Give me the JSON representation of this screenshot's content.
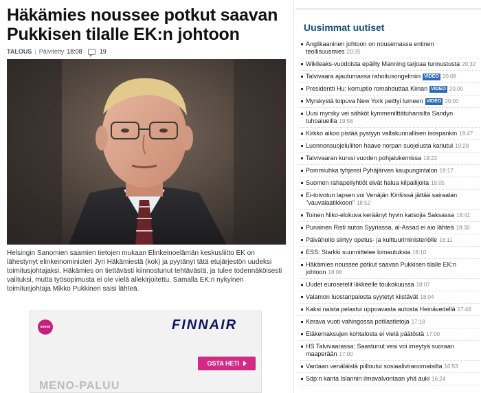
{
  "article": {
    "headline": "Häkämies noussee potkut saavan Pukkisen tilalle EK:n johtoon",
    "category": "TALOUS",
    "updated_label": "Päivitetty",
    "updated_time": "18:08",
    "comment_count": "19",
    "body": "Helsingin Sanomien saamien tietojen mukaan Elinkeinoelämän keskusliitto EK on lähestynyt elinkeinoministeri Jyri Häkämiestä (kok) ja pyytänyt tätä etujärjestön uudeksi toimitusjohtajaksi. Häkämies on tiettävästi kiinnostunut tehtävästä, ja tulee todennäköisesti valituksi, mutta työsopimusta ei ole vielä allekirjoitettu. Samalla EK:n nykyinen toimitusjohtaja Mikko Pukkinen saisi lähteä."
  },
  "ad": {
    "brand_small": "omnet",
    "logo": "FINNAIR",
    "cta": "OSTA HETI",
    "promo": "MENO-PALUU"
  },
  "sidebar": {
    "title": "Uusimmat uutiset",
    "video_label": "VIDEO",
    "items": [
      {
        "text": "Anglikaaninen johtoon on nousemassa entinen teollisuusmies",
        "time": "20:35",
        "video": false
      },
      {
        "text": "Wikileaks-vuodoista epäilty Manning tarjoaa tunnustusta",
        "time": "20:32",
        "video": false
      },
      {
        "text": "Talvivaara ajautumassa rahoitusongelmiin",
        "time": "20:08",
        "video": true
      },
      {
        "text": "Presidentti Hu: korruptio romahduttaa Kiinan",
        "time": "20:00",
        "video": true
      },
      {
        "text": "Myrskystä toipuva New York peittyi lumeen",
        "time": "20:00",
        "video": true
      },
      {
        "text": "Uusi myrsky vei sähköt kymmenilttätuhansilta Sandyn tuhoalueilla",
        "time": "19:58",
        "video": false
      },
      {
        "text": "Kirkko aikoo pistää pystyyn valtakunnallisen isospankin",
        "time": "19:47",
        "video": false
      },
      {
        "text": "Luonnonsuojeluliiton haave norpan suojelusta kariutui",
        "time": "19:28",
        "video": false
      },
      {
        "text": "Talvivaaran kurssi vuoden pohjalukemissa",
        "time": "19:22",
        "video": false
      },
      {
        "text": "Pommiuhka tyhjensi Pyhäjärven kaupungintalon",
        "time": "19:17",
        "video": false
      },
      {
        "text": "Suomen rahapeliyhtiöt eivät halua kilpailijoita",
        "time": "19:05",
        "video": false
      },
      {
        "text": "Ei-toivotun lapsen voi Venäjän Kirišissä jättää sairaalan \"vauvalaatikkoon\"",
        "time": "18:52",
        "video": false
      },
      {
        "text": "Toinen Niko-elokuva keräänyt hyvin katsojia Saksassa",
        "time": "18:41",
        "video": false
      },
      {
        "text": "Punainen Risti auton Syyriassa, al-Assad ei aio lähteä",
        "time": "18:30",
        "video": false
      },
      {
        "text": "Päivähoito siirtyy opetus- ja kulttuuriministeriölle",
        "time": "18:11",
        "video": false
      },
      {
        "text": "ESS: Starkki suunnittelee lomautuksia",
        "time": "18:10",
        "video": false
      },
      {
        "text": "Häkämies noussee potkut saavan Pukkisen tilalle EK:n johtoon",
        "time": "18:08",
        "video": false
      },
      {
        "text": "Uudet eurosetelit liikkeelle toukokuussa",
        "time": "18:07",
        "video": false
      },
      {
        "text": "Valamon luostaripalosta syytetyt kiistävät",
        "time": "18:04",
        "video": false
      },
      {
        "text": "Kaksi naista pelastui uppoavasta autosta Heinävedellä",
        "time": "17:46",
        "video": false
      },
      {
        "text": "Kerava vuoti vahingossa potilastietoja",
        "time": "17:18",
        "video": false
      },
      {
        "text": "Eläkemaksujen kohtalosta ei vielä päätöstä",
        "time": "17:00",
        "video": false
      },
      {
        "text": "HS Talvivaarassa: Saastunut vesi voi imeytyä suoraan maaperään",
        "time": "17:00",
        "video": false
      },
      {
        "text": "Vantaan venäläistä piilloutui sosiaaliviranomaisilta",
        "time": "16:53",
        "video": false
      },
      {
        "text": "Sdp:n kanta Islannin ilmavalvontaan yhä auki",
        "time": "16:24",
        "video": false
      }
    ]
  }
}
